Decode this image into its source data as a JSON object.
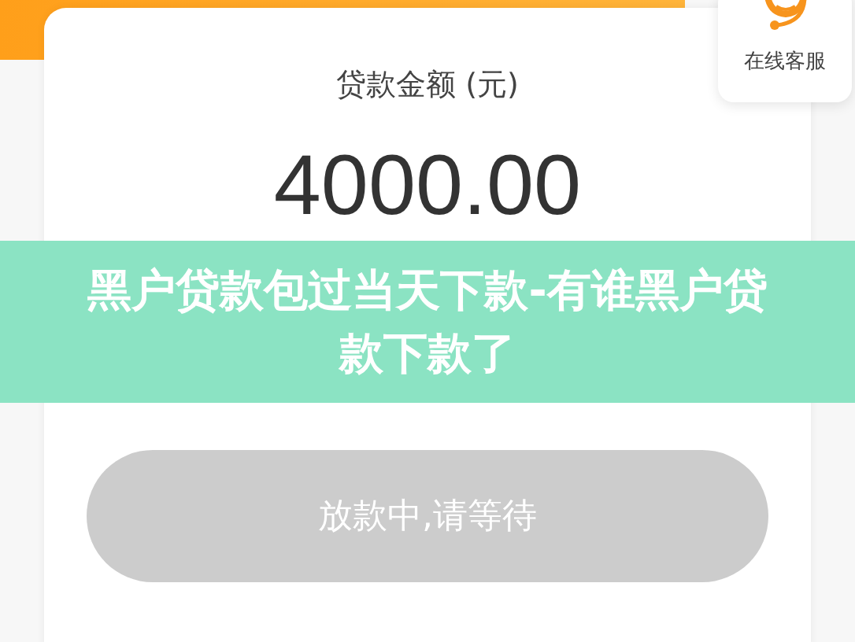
{
  "support": {
    "label": "在线客服"
  },
  "loan": {
    "label": "贷款金额 (元)",
    "amount": "4000.00"
  },
  "action_button": {
    "label": "放款中,请等待",
    "disabled": true
  },
  "banner": {
    "title": "黑户贷款包过当天下款-有谁黑户贷款下款了"
  }
}
